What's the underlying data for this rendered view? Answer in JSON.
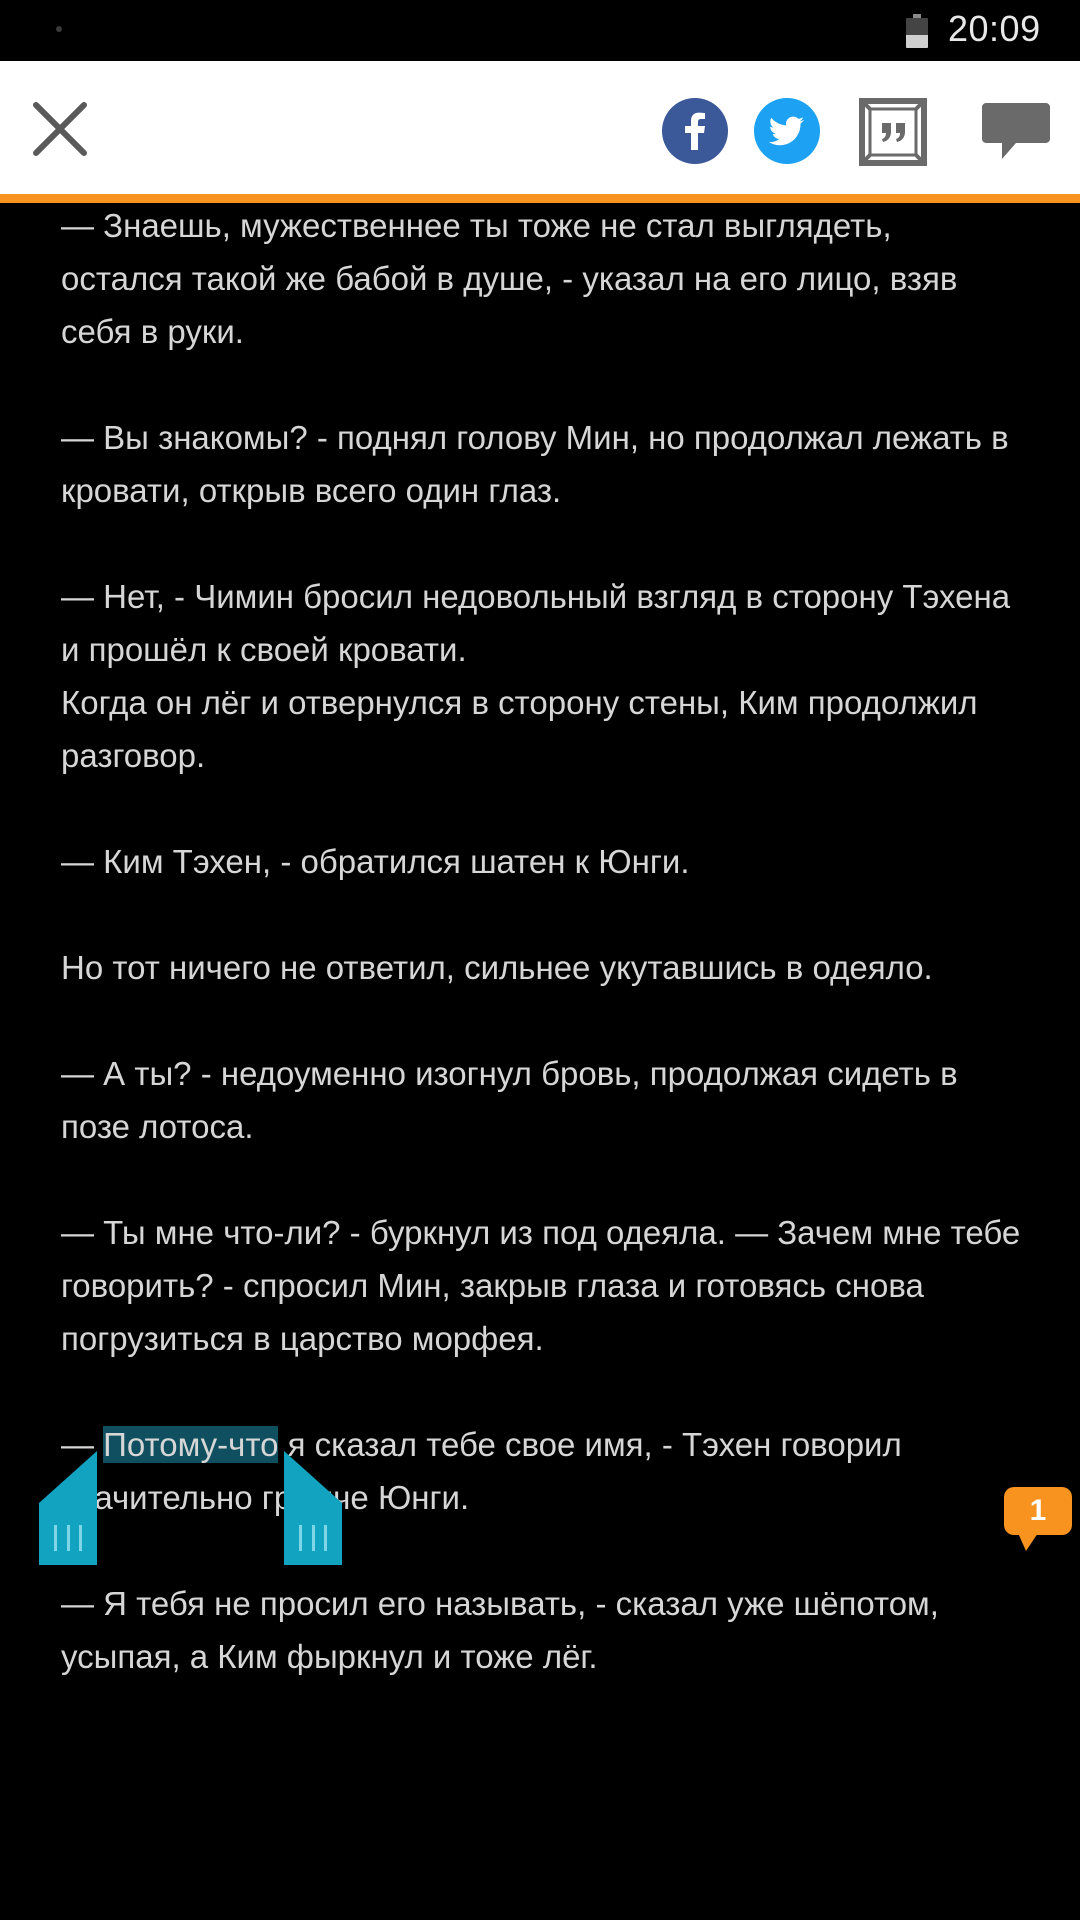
{
  "status_bar": {
    "time": "20:09",
    "battery_level": 0.45
  },
  "toolbar": {
    "close_icon": "close-icon",
    "share_icons": [
      "facebook-icon",
      "twitter-icon",
      "quote-frame-icon",
      "comment-icon"
    ]
  },
  "colors": {
    "accent": "#f7931e",
    "selection": "#0f4f5f",
    "handles": "#11a3c0",
    "facebook": "#3b5998",
    "twitter": "#1da1f2"
  },
  "text": {
    "p1": "— Знаешь, мужественнее ты тоже не стал выглядеть, остался такой же бабой в душе, - указал на его лицо, взяв себя в руки.",
    "p2": "— Вы знакомы? - поднял голову Мин, но продолжал лежать в кровати, открыв всего один глаз.",
    "p3": "— Нет, - Чимин бросил недовольный взгляд в сторону Тэхена и прошёл к своей кровати.\nКогда он лёг и отвернулся в сторону стены, Ким продолжил разговор.",
    "p4": "— Ким Тэхен, - обратился шатен к Юнги.",
    "p5": "Но тот ничего не ответил, сильнее укутавшись в одеяло.",
    "p6": "— А ты? - недоуменно изогнул бровь, продолжая сидеть в позе лотоса.",
    "p7": "— Ты мне что-ли? - буркнул из под одеяла. — Зачем мне тебе говорить? - спросил Мин, закрыв глаза и готовясь снова погрузиться в царство морфея.",
    "p8_before": "— ",
    "p8_selected": "Потому-что",
    "p8_after": " я сказал тебе свое имя, - Тэхен говорил значительно громче Юнги.",
    "p9": "— Я тебя не просил его называть, - сказал уже шёпотом, усыпая, а Ким фыркнул и тоже лёг."
  },
  "comment_badge": {
    "count": "1"
  }
}
